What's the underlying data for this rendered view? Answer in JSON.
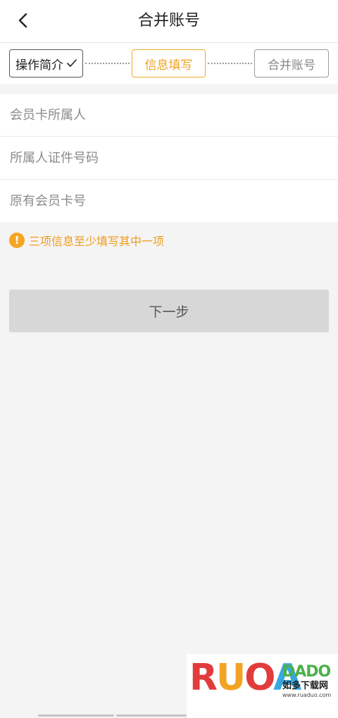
{
  "header": {
    "title": "合并账号"
  },
  "steps": [
    {
      "label": "操作简介",
      "state": "done"
    },
    {
      "label": "信息填写",
      "state": "active"
    },
    {
      "label": "合并账号",
      "state": "pending"
    }
  ],
  "form": {
    "fields": [
      {
        "value": "",
        "placeholder": "会员卡所属人"
      },
      {
        "value": "",
        "placeholder": "所属人证件号码"
      },
      {
        "value": "",
        "placeholder": "原有会员卡号"
      }
    ]
  },
  "notice": {
    "icon": "exclamation-icon",
    "symbol": "!",
    "text": "三项信息至少填写其中一项"
  },
  "actions": {
    "next_label": "下一步"
  },
  "watermark": {
    "letters": [
      "R",
      "U",
      "O",
      "A"
    ],
    "brand": "DADO",
    "cn": "如多下载网",
    "url": "www.ruaduo.com"
  },
  "colors": {
    "accent": "#f0a020",
    "notice": "#f5a623",
    "button_bg": "#d7d7d7",
    "page_bg": "#f4f4f4"
  }
}
